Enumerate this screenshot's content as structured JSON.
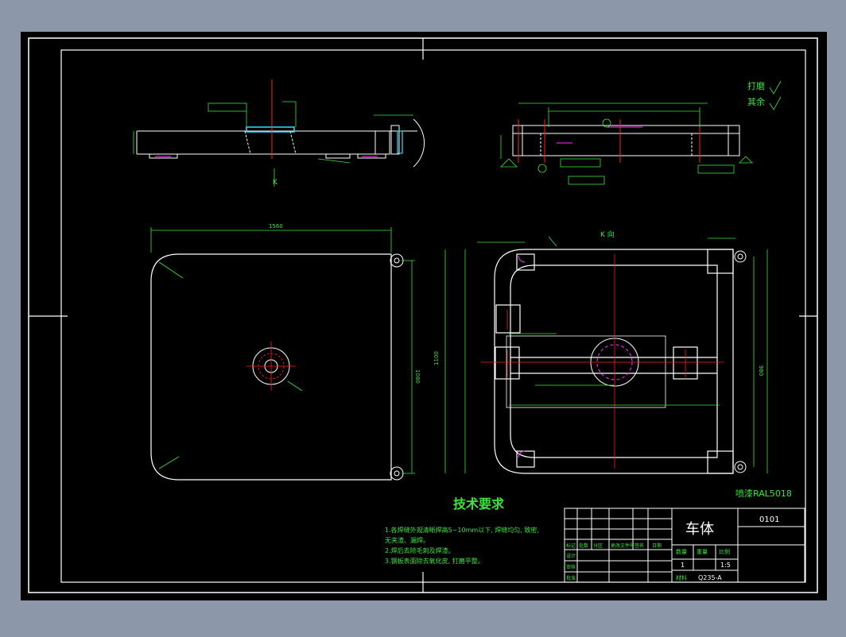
{
  "drawing": {
    "title_cn": "车体",
    "drawing_no": "0101",
    "tech_req_heading": "技术要求",
    "tech_req_lines": [
      "1.各焊缝外观清晰焊高5~10mm以下, 焊缝均匀, 致密,",
      "  无夹渣、漏焊。",
      "2.焊后去除毛刺及焊渣。",
      "3.钢板表面除去氧化皮, 打磨平整。"
    ],
    "paint_note": "喷漆RAL5018",
    "view_label_k": "K",
    "view_label_k2": "K 向",
    "roughness_note_1": "打磨",
    "roughness_note_2": "其余",
    "dim_top_width": "1560",
    "dim_side_height": "1080",
    "dim_frame_height": "1100",
    "dim_right_height": "980"
  },
  "title_block": {
    "scale_label": "比例",
    "scale_value": "1:5",
    "qty_label": "数量",
    "qty_value": "1",
    "weight_label": "重量",
    "material_label": "材料",
    "material_value": "Q235-A",
    "row_labels": [
      "标记",
      "处数",
      "分区",
      "更改文件号",
      "签名",
      "日期"
    ],
    "role_labels": [
      "设计",
      "审核",
      "工艺",
      "批准"
    ]
  },
  "colors": {
    "canvas": "#000000",
    "window": "#8c98aa",
    "line_white": "#ffffff",
    "line_green": "#39e639",
    "line_red": "#ff2020",
    "line_magenta": "#ff30ff",
    "line_cyan": "#30e0ff"
  }
}
